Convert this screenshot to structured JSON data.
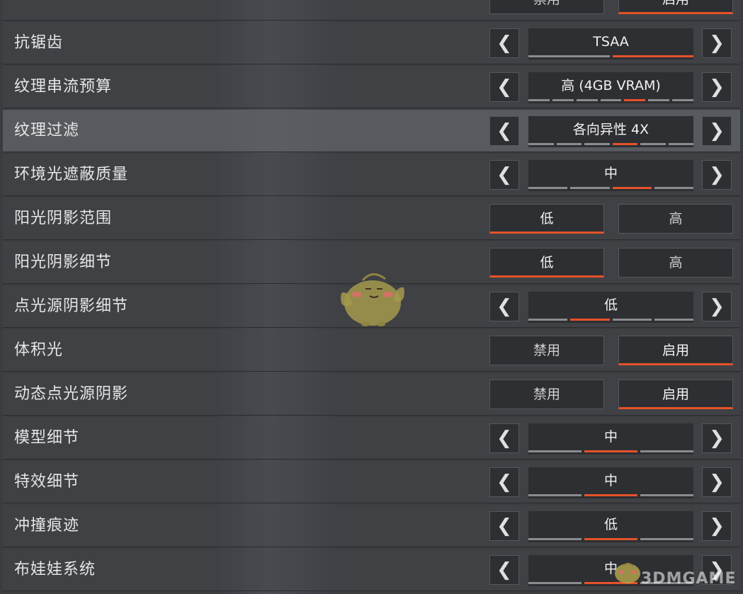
{
  "watermark": "3DMGAME",
  "colors": {
    "accent": "#e5522a",
    "background": "#3b3c40",
    "control": "#2e2f33"
  },
  "icons": {
    "left": "chevron-left-icon",
    "right": "chevron-right-icon",
    "arrow_left_glyph": "❮",
    "arrow_right_glyph": "❯"
  },
  "rows": [
    {
      "label": "",
      "type": "toggle",
      "options": [
        "禁用",
        "启用"
      ],
      "selected": 1
    },
    {
      "label": "抗锯齿",
      "type": "carousel",
      "value": "TSAA",
      "segments": 2,
      "active": 1
    },
    {
      "label": "纹理串流预算",
      "type": "carousel",
      "value": "高 (4GB VRAM)",
      "segments": 7,
      "active": 4
    },
    {
      "label": "纹理过滤",
      "type": "carousel",
      "value": "各向异性 4X",
      "segments": 6,
      "active": 3
    },
    {
      "label": "环境光遮蔽质量",
      "type": "carousel",
      "value": "中",
      "segments": 4,
      "active": 2
    },
    {
      "label": "阳光阴影范围",
      "type": "toggle",
      "options": [
        "低",
        "高"
      ],
      "selected": 0
    },
    {
      "label": "阳光阴影细节",
      "type": "toggle",
      "options": [
        "低",
        "高"
      ],
      "selected": 0
    },
    {
      "label": "点光源阴影细节",
      "type": "carousel",
      "value": "低",
      "segments": 4,
      "active": 1
    },
    {
      "label": "体积光",
      "type": "toggle",
      "options": [
        "禁用",
        "启用"
      ],
      "selected": 1
    },
    {
      "label": "动态点光源阴影",
      "type": "toggle",
      "options": [
        "禁用",
        "启用"
      ],
      "selected": 1
    },
    {
      "label": "模型细节",
      "type": "carousel",
      "value": "中",
      "segments": 3,
      "active": 1
    },
    {
      "label": "特效细节",
      "type": "carousel",
      "value": "中",
      "segments": 3,
      "active": 1
    },
    {
      "label": "冲撞痕迹",
      "type": "carousel",
      "value": "低",
      "segments": 3,
      "active": 1
    },
    {
      "label": "布娃娃系统",
      "type": "carousel",
      "value": "中",
      "segments": 3,
      "active": 1
    }
  ]
}
